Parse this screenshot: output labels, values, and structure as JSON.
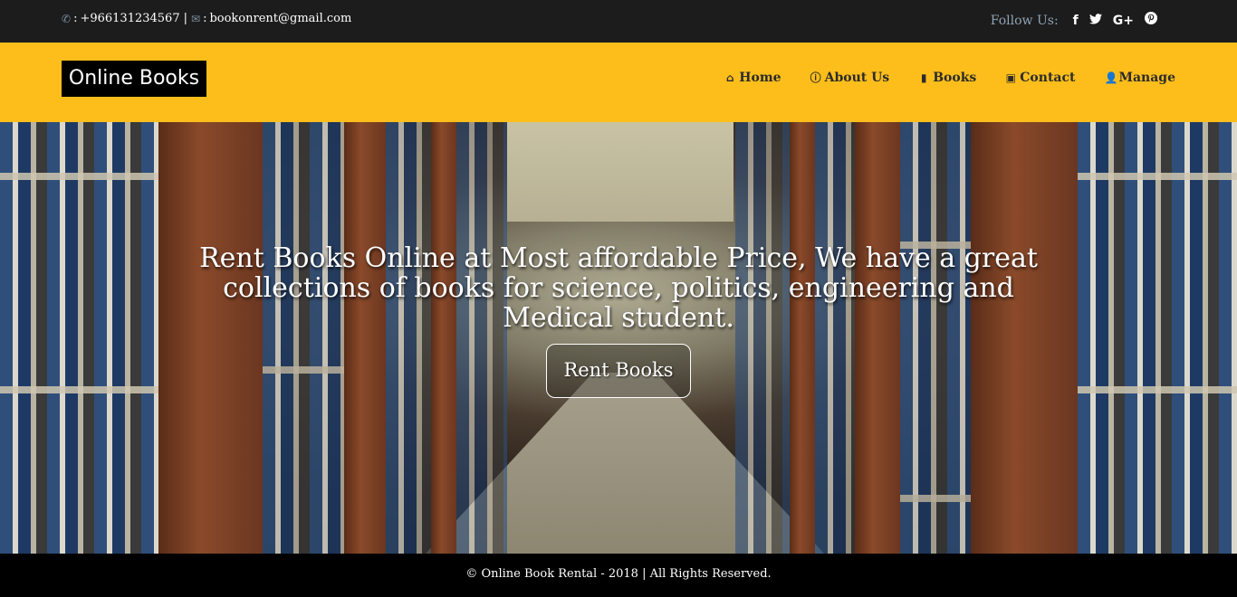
{
  "topbar": {
    "phone": "+966131234567",
    "email": "bookonrent@gmail.com",
    "phone_icon": "phone-icon",
    "email_icon": "envelope-icon",
    "follow_label": "Follow Us:",
    "social": [
      {
        "name": "facebook-icon",
        "glyph": "f"
      },
      {
        "name": "twitter-icon",
        "glyph": "🐦"
      },
      {
        "name": "google-plus-icon",
        "glyph": "G+"
      },
      {
        "name": "pinterest-icon",
        "glyph": "℗"
      }
    ]
  },
  "nav": {
    "logo": "Online Books",
    "items": [
      {
        "label": "Home",
        "icon": "home-icon"
      },
      {
        "label": "About Us",
        "icon": "info-circle-icon"
      },
      {
        "label": "Books",
        "icon": "book-icon"
      },
      {
        "label": "Contact",
        "icon": "contact-card-icon"
      },
      {
        "label": "Manage",
        "icon": "user-icon"
      }
    ]
  },
  "hero": {
    "headline": "Rent Books Online at Most affordable Price, We have a great collections of books for science, politics, engineering and Medical student.",
    "button": "Rent Books"
  },
  "footer": {
    "text": "© Online Book Rental - 2018 | All Rights Reserved."
  },
  "colors": {
    "topbar_bg": "#1c1c1c",
    "nav_bg": "#fdbe1b",
    "logo_bg": "#000000",
    "footer_bg": "#000000"
  }
}
